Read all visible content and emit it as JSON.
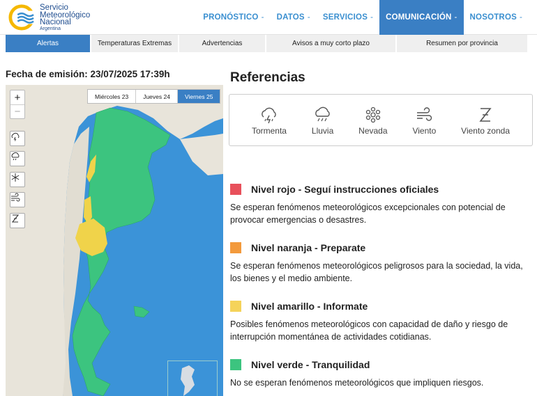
{
  "brand": {
    "line1": "Servicio",
    "line2": "Meteorológico",
    "line3": "Nacional",
    "line4": "Argentina",
    "color": "#1f4d8f",
    "accent": "#f5b800"
  },
  "nav": {
    "items": [
      {
        "label": "PRONÓSTICO",
        "caret": "-",
        "active": false
      },
      {
        "label": "DATOS",
        "caret": "-",
        "active": false
      },
      {
        "label": "SERVICIOS",
        "caret": "-",
        "active": false
      },
      {
        "label": "COMUNICACIÓN",
        "caret": "-",
        "active": true
      },
      {
        "label": "NOSOTROS",
        "caret": "-",
        "active": false
      }
    ]
  },
  "tabs": [
    {
      "label": "Alertas",
      "active": true
    },
    {
      "label": "Temperaturas Extremas",
      "active": false
    },
    {
      "label": "Advertencias",
      "active": false
    },
    {
      "label": "Avisos a muy corto plazo",
      "active": false
    },
    {
      "label": "Resumen por provincia",
      "active": false
    }
  ],
  "emision": "Fecha de emisión: 23/07/2025 17:39h",
  "map": {
    "zoom_in": "+",
    "zoom_out": "−",
    "days": [
      {
        "label": "Miércoles 23",
        "active": false
      },
      {
        "label": "Jueves 24",
        "active": false
      },
      {
        "label": "Viernes 25",
        "active": true
      }
    ],
    "layers": [
      "storm-icon",
      "rain-icon",
      "snow-icon",
      "wind-icon",
      "zonda-wind-icon"
    ],
    "colors": {
      "water": "#3b93d8",
      "land": "#e8e4da",
      "green": "#3cc47f",
      "yellow": "#f0d34a"
    }
  },
  "references": {
    "title": "Referencias",
    "items": [
      {
        "label": "Tormenta",
        "icon": "storm-icon"
      },
      {
        "label": "Lluvia",
        "icon": "rain-icon"
      },
      {
        "label": "Nevada",
        "icon": "snow-icon"
      },
      {
        "label": "Viento",
        "icon": "wind-icon"
      },
      {
        "label": "Viento zonda",
        "icon": "zonda-wind-icon"
      }
    ]
  },
  "levels": [
    {
      "title": "Nivel rojo - Seguí instrucciones oficiales",
      "color": "#e8505b",
      "desc": "Se esperan fenómenos meteorológicos excepcionales con potencial de provocar emergencias o desastres."
    },
    {
      "title": "Nivel naranja - Preparate",
      "color": "#f39a3c",
      "desc": "Se esperan fenómenos meteorológicos peligrosos para la sociedad, la vida, los bienes y el medio ambiente."
    },
    {
      "title": "Nivel amarillo - Informate",
      "color": "#f5d35a",
      "desc": "Posibles fenómenos meteorológicos con capacidad de daño y riesgo de interrupción momentánea de actividades cotidianas."
    },
    {
      "title": "Nivel verde - Tranquilidad",
      "color": "#3cc47f",
      "desc": "No se esperan fenómenos meteorológicos que impliquen riesgos."
    }
  ]
}
